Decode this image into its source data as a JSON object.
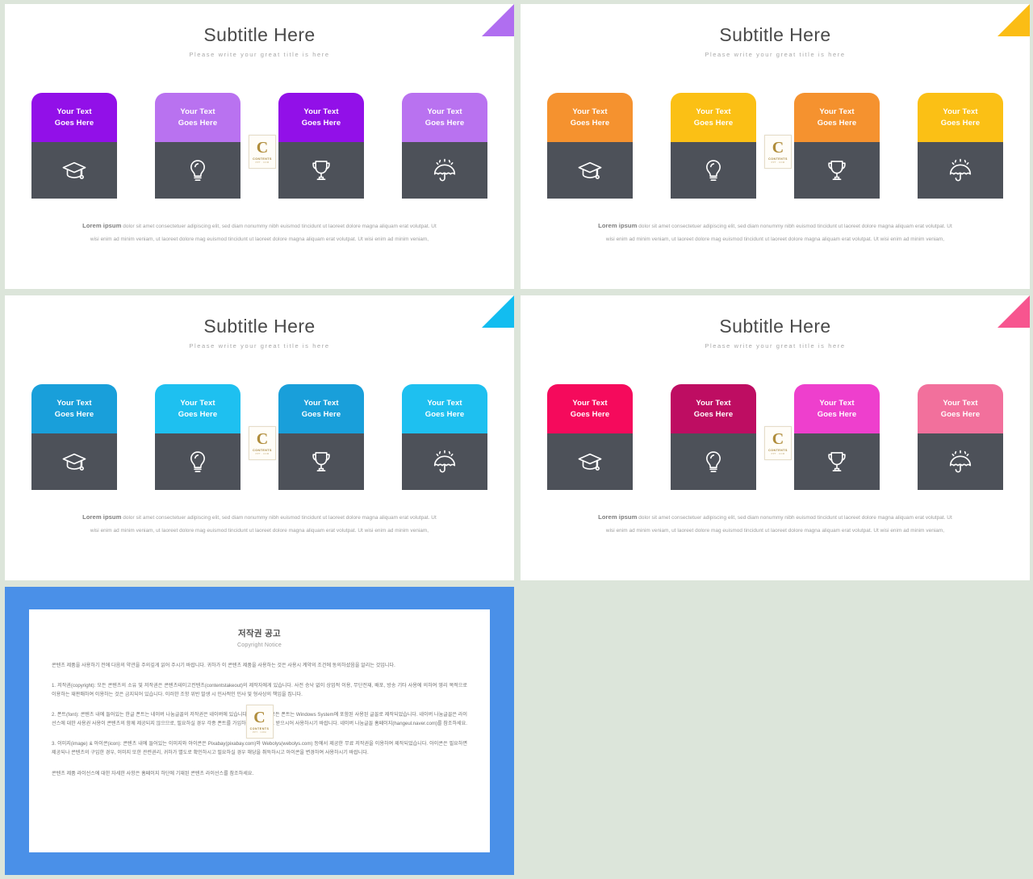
{
  "background_color": "#dce5da",
  "card_icon_bg": "#4d5159",
  "slides": [
    {
      "id": "slide-purple",
      "corner_color": "#b06ef0",
      "title": "Subtitle Here",
      "subtitle": "Please write your great title is here",
      "cards": [
        {
          "color": "#9210e8",
          "label": "Your Text\nGoes Here",
          "icon": "graduation-cap-icon"
        },
        {
          "color": "#b972f0",
          "label": "Your Text\nGoes Here",
          "icon": "lightbulb-icon"
        },
        {
          "color": "#9210e8",
          "label": "Your Text\nGoes Here",
          "icon": "trophy-icon"
        },
        {
          "color": "#b972f0",
          "label": "Your Text\nGoes Here",
          "icon": "umbrella-rain-icon"
        }
      ],
      "body_lead": "Lorem ipsum",
      "body_text": " dolor sit amet consectetuer adipiscing elit, sed diam nonummy nibh euismod tincidunt ut laoreet dolore magna aliquam erat volutpat. Ut wisi enim ad minim veniam, ut laoreet dolore mag euismod tincidunt ut laoreet dolore magna aliquam erat volutpat. Ut wisi enim ad minim veniam,"
    },
    {
      "id": "slide-orange",
      "corner_color": "#fbbd15",
      "title": "Subtitle Here",
      "subtitle": "Please write your great title is here",
      "cards": [
        {
          "color": "#f5922f",
          "label": "Your Text\nGoes Here",
          "icon": "graduation-cap-icon"
        },
        {
          "color": "#fbc015",
          "label": "Your Text\nGoes Here",
          "icon": "lightbulb-icon"
        },
        {
          "color": "#f5922f",
          "label": "Your Text\nGoes Here",
          "icon": "trophy-icon"
        },
        {
          "color": "#fbc015",
          "label": "Your Text\nGoes Here",
          "icon": "umbrella-rain-icon"
        }
      ],
      "body_lead": "Lorem ipsum",
      "body_text": " dolor sit amet consectetuer adipiscing elit, sed diam nonummy nibh euismod tincidunt ut laoreet dolore magna aliquam erat volutpat. Ut wisi enim ad minim veniam, ut laoreet dolore mag euismod tincidunt ut laoreet dolore magna aliquam erat volutpat. Ut wisi enim ad minim veniam,"
    },
    {
      "id": "slide-blue",
      "corner_color": "#12bdf0",
      "title": "Subtitle Here",
      "subtitle": "Please write your great title is here",
      "cards": [
        {
          "color": "#199fda",
          "label": "Your Text\nGoes Here",
          "icon": "graduation-cap-icon"
        },
        {
          "color": "#1ec0f0",
          "label": "Your Text\nGoes Here",
          "icon": "lightbulb-icon"
        },
        {
          "color": "#199fda",
          "label": "Your Text\nGoes Here",
          "icon": "trophy-icon"
        },
        {
          "color": "#1ec0f0",
          "label": "Your Text\nGoes Here",
          "icon": "umbrella-rain-icon"
        }
      ],
      "body_lead": "Lorem ipsum",
      "body_text": " dolor sit amet consectetuer adipiscing elit, sed diam nonummy nibh euismod tincidunt ut laoreet dolore magna aliquam erat volutpat. Ut wisi enim ad minim veniam, ut laoreet dolore mag euismod tincidunt ut laoreet dolore magna aliquam erat volutpat. Ut wisi enim ad minim veniam,"
    },
    {
      "id": "slide-pink",
      "corner_color": "#f7558f",
      "title": "Subtitle Here",
      "subtitle": "Please write your great title is here",
      "cards": [
        {
          "color": "#f50a5c",
          "label": "Your Text\nGoes Here",
          "icon": "graduation-cap-icon"
        },
        {
          "color": "#be0d62",
          "label": "Your Text\nGoes Here",
          "icon": "lightbulb-icon"
        },
        {
          "color": "#ee3fcd",
          "label": "Your Text\nGoes Here",
          "icon": "trophy-icon"
        },
        {
          "color": "#f2709c",
          "label": "Your Text\nGoes Here",
          "icon": "umbrella-rain-icon"
        }
      ],
      "body_lead": "Lorem ipsum",
      "body_text": " dolor sit amet consectetuer adipiscing elit, sed diam nonummy nibh euismod tincidunt ut laoreet dolore magna aliquam erat volutpat. Ut wisi enim ad minim veniam, ut laoreet dolore mag euismod tincidunt ut laoreet dolore magna aliquam erat volutpat. Ut wisi enim ad minim veniam,"
    }
  ],
  "watermark": {
    "letter": "C",
    "line1": "CONTENTS",
    "line2": "PPT . COM"
  },
  "copyright_slide": {
    "border_color": "#4a90e8",
    "title_ko": "저작권 공고",
    "title_en": "Copyright Notice",
    "paragraphs": [
      "콘텐츠 제품을 사용하기 전에 다음의 약관을 주의깊게 읽어 주시기 바랍니다. 귀하가 이 콘텐츠 제품을 사용하는 것은 사용시 계약의 조건에 동의하셨음을 알리는 것입니다.",
      "1. 저작권(copyright): 모든 콘텐츠의 소유 및 저작권은 콘텐츠테이고컨텐츠(contentstakeout)의 제작자에게 있습니다. 사전 승낙 없이 상업적 이용, 무단전재, 배포, 방송 기타 사용에 의하여 영리 목적으로 이용하는 재판매하여 이용하는 것은 금지되어 있습니다. 이러한 조항 위반 발생 시 민사적인 민사 및 형사상의 책임을 집니다.",
      "2. 폰트(font): 콘텐츠 내에 들어있는 한글 폰트는 네이버 나눔글꼴의 저작권은 네이버에 있습니다. 한글 외의 모든 폰트는 Windows System에 포함된 사용된 글꼴로 제작되었습니다. 네이버 나눔글꼴은 라이선스에 대한 사용권 사용이 콘텐츠의 함께 제공되지 않으므로, 필요하실 경우 각종 폰트를 가입하셔서 다운로드 받으시어 사용하시기 바랍니다. 네이버 나눔글꼴 홈페이지(hangeul.naver.com)를 참조하세요.",
      "3. 이미지(image) & 아이콘(icon): 콘텐츠 내에 들어있는 이미지와 아이콘은 Pixabay(pixabay.com)와 Webolys(webolys.com) 등에서 제공한 무료 저작권을 이용하여 제작되었습니다. 아이콘은 필요하면 제공되나 콘텐츠의 구입한 경우, 이미지 또한 관련권리, 귀하가 별도로 확인하시고 필요하실 경우 해당을 취득하시고 아이콘을 변경하여 사용하시기 바랍니다.",
      "콘텐츠 제품 라이선스에 대한 자세한 사항은 홈페이지 하단에 기재된 콘텐츠 라이선스를 참조하세요."
    ]
  }
}
